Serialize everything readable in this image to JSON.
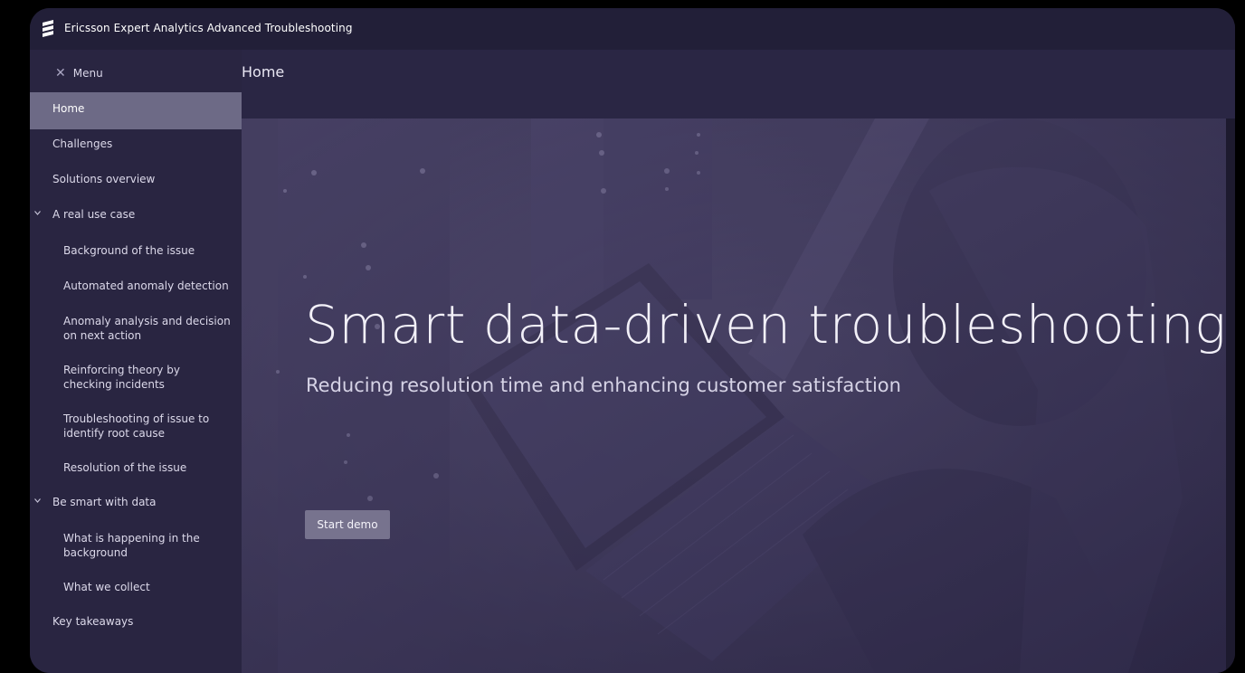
{
  "app": {
    "title": "Ericsson Expert Analytics Advanced Troubleshooting"
  },
  "sidebar": {
    "menu_label": "Menu",
    "items": [
      {
        "label": "Home",
        "level": 0,
        "active": true
      },
      {
        "label": "Challenges",
        "level": 0
      },
      {
        "label": "Solutions overview",
        "level": 0
      },
      {
        "label": "A real use case",
        "level": 0,
        "expanded": true
      },
      {
        "label": "Background of the issue",
        "level": 1
      },
      {
        "label": "Automated anomaly detection",
        "level": 1
      },
      {
        "label": "Anomaly analysis and decision on next action",
        "level": 1
      },
      {
        "label": "Reinforcing theory by checking incidents",
        "level": 1
      },
      {
        "label": "Troubleshooting of issue to identify root cause",
        "level": 1
      },
      {
        "label": "Resolution of the issue",
        "level": 1
      },
      {
        "label": "Be smart with data",
        "level": 0,
        "expanded": true
      },
      {
        "label": "What is happening in the background",
        "level": 1
      },
      {
        "label": "What we collect",
        "level": 1
      },
      {
        "label": "Key takeaways",
        "level": 0
      }
    ]
  },
  "main": {
    "page_title": "Home",
    "hero": {
      "title": "Smart data-driven troubleshooting",
      "subtitle": "Reducing resolution time and enhancing customer satisfaction",
      "cta_label": "Start demo"
    }
  },
  "colors": {
    "titlebar": "#221f38",
    "sidebar": "#292541",
    "active_item": "#6d6a86",
    "button": "#77738e"
  }
}
